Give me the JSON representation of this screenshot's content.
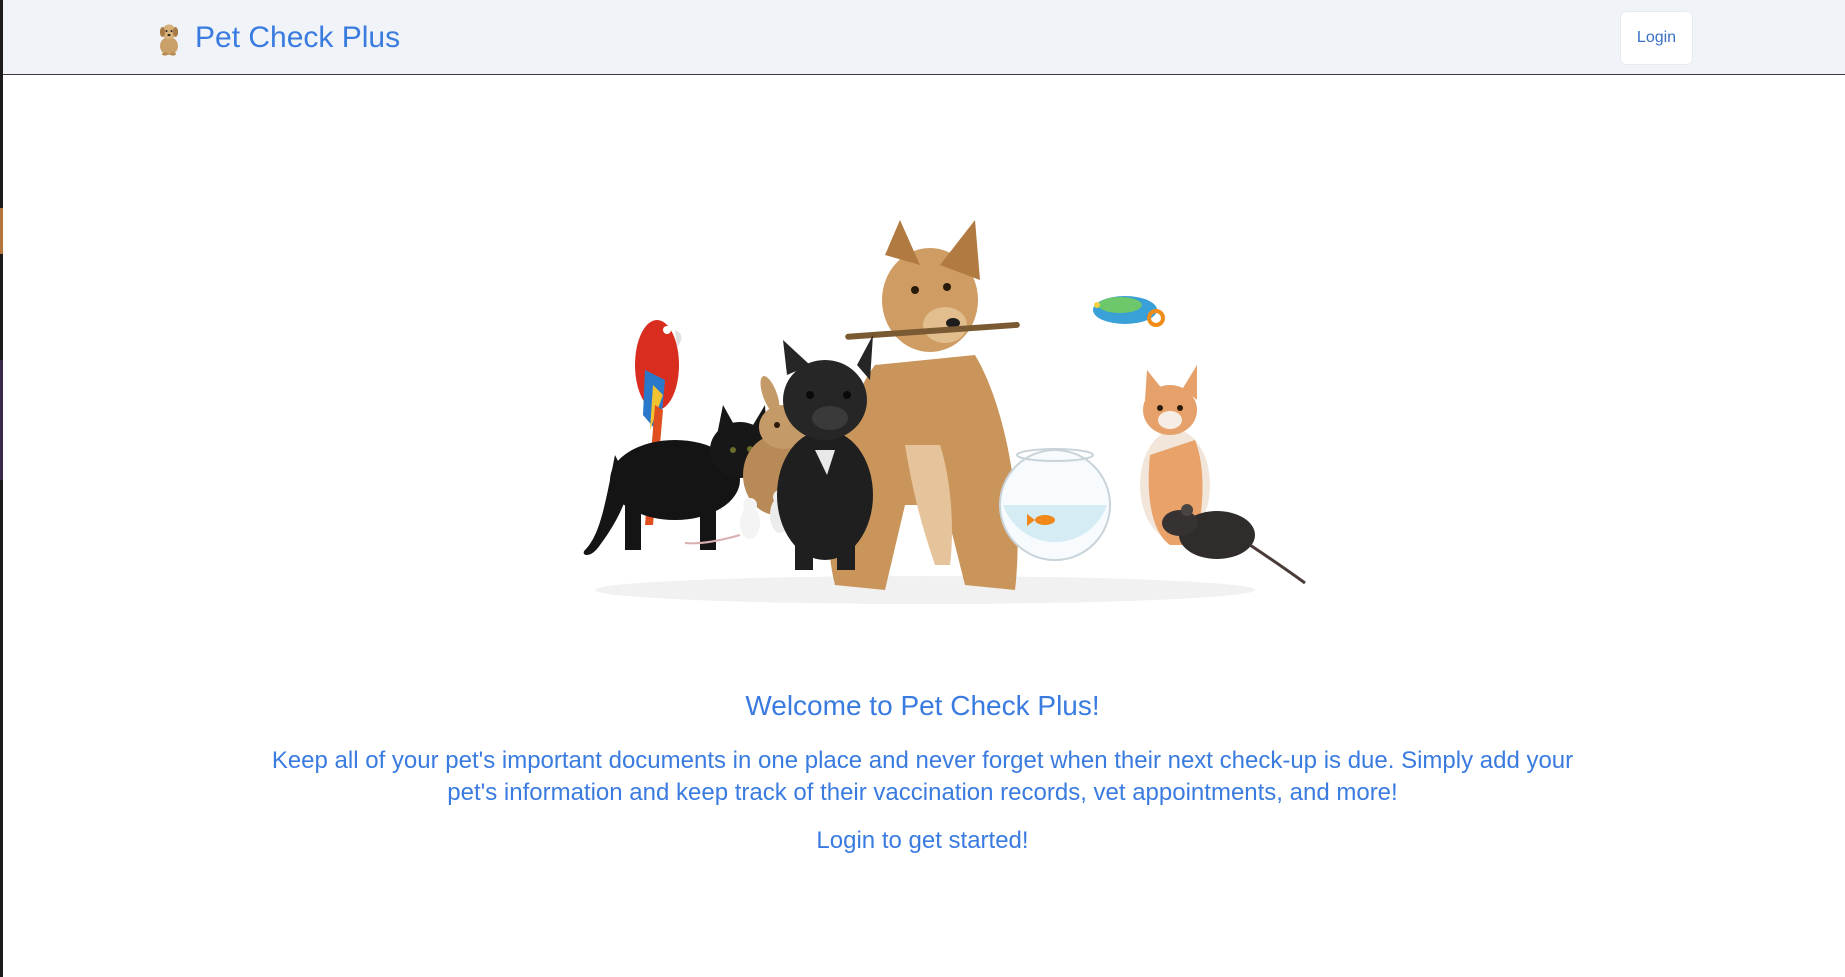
{
  "header": {
    "brand_name": "Pet Check Plus",
    "brand_icon": "dog-icon",
    "login_label": "Login"
  },
  "hero": {
    "image": "pets-group-illustration"
  },
  "main": {
    "welcome_title": "Welcome to Pet Check Plus!",
    "description": "Keep all of your pet's important documents in one place and never forget when their next check-up is due. Simply add your pet's information and keep track of their vaccination records, vet appointments, and more!",
    "cta_text": "Login to get started!"
  },
  "colors": {
    "accent": "#3a7be0",
    "navbar_bg": "#f0f3f8"
  }
}
